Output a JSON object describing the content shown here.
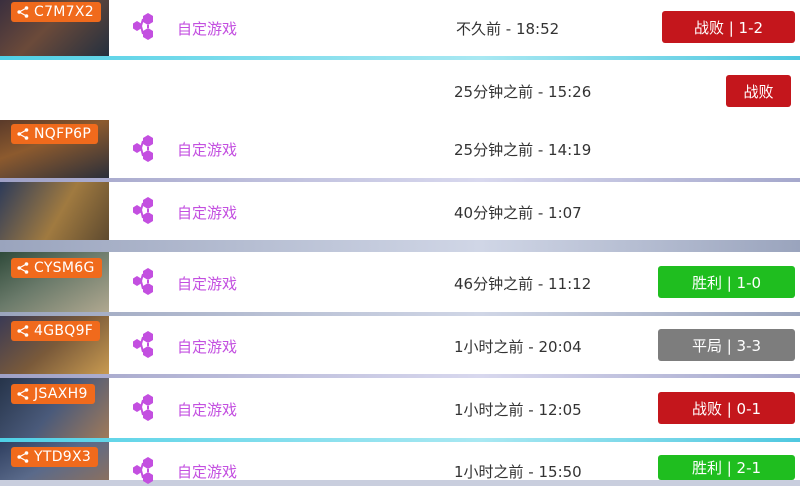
{
  "matches": [
    {
      "code": "C7M7X2",
      "mode": "自定游戏",
      "time": "不久前 - 18:52",
      "result": "战败 | 1-2",
      "result_type": "loss"
    },
    {
      "code": "",
      "mode": "",
      "time": "25分钟之前 - 15:26",
      "result": "战败",
      "result_type": "loss"
    },
    {
      "code": "NQFP6P",
      "mode": "自定游戏",
      "time": "25分钟之前 - 14:19",
      "result": "",
      "result_type": ""
    },
    {
      "code": "",
      "mode": "自定游戏",
      "time": "40分钟之前 - 1:07",
      "result": "",
      "result_type": ""
    },
    {
      "code": "CYSM6G",
      "mode": "自定游戏",
      "time": "46分钟之前 - 11:12",
      "result": "胜利 | 1-0",
      "result_type": "win"
    },
    {
      "code": "4GBQ9F",
      "mode": "自定游戏",
      "time": "1小时之前 - 20:04",
      "result": "平局 | 3-3",
      "result_type": "draw"
    },
    {
      "code": "JSAXH9",
      "mode": "自定游戏",
      "time": "1小时之前 - 12:05",
      "result": "战败 | 0-1",
      "result_type": "loss"
    },
    {
      "code": "YTD9X3",
      "mode": "自定游戏",
      "time": "1小时之前 - 15:50",
      "result": "胜利 | 2-1",
      "result_type": "win"
    }
  ],
  "colors": {
    "code_badge": "#f06a1c",
    "mode_text": "#c34fe0",
    "loss": "#c4161c",
    "win": "#1fbe1f",
    "draw": "#7d7d7d"
  },
  "icons": {
    "share": "share-icon",
    "mode": "custom-game-icon"
  }
}
